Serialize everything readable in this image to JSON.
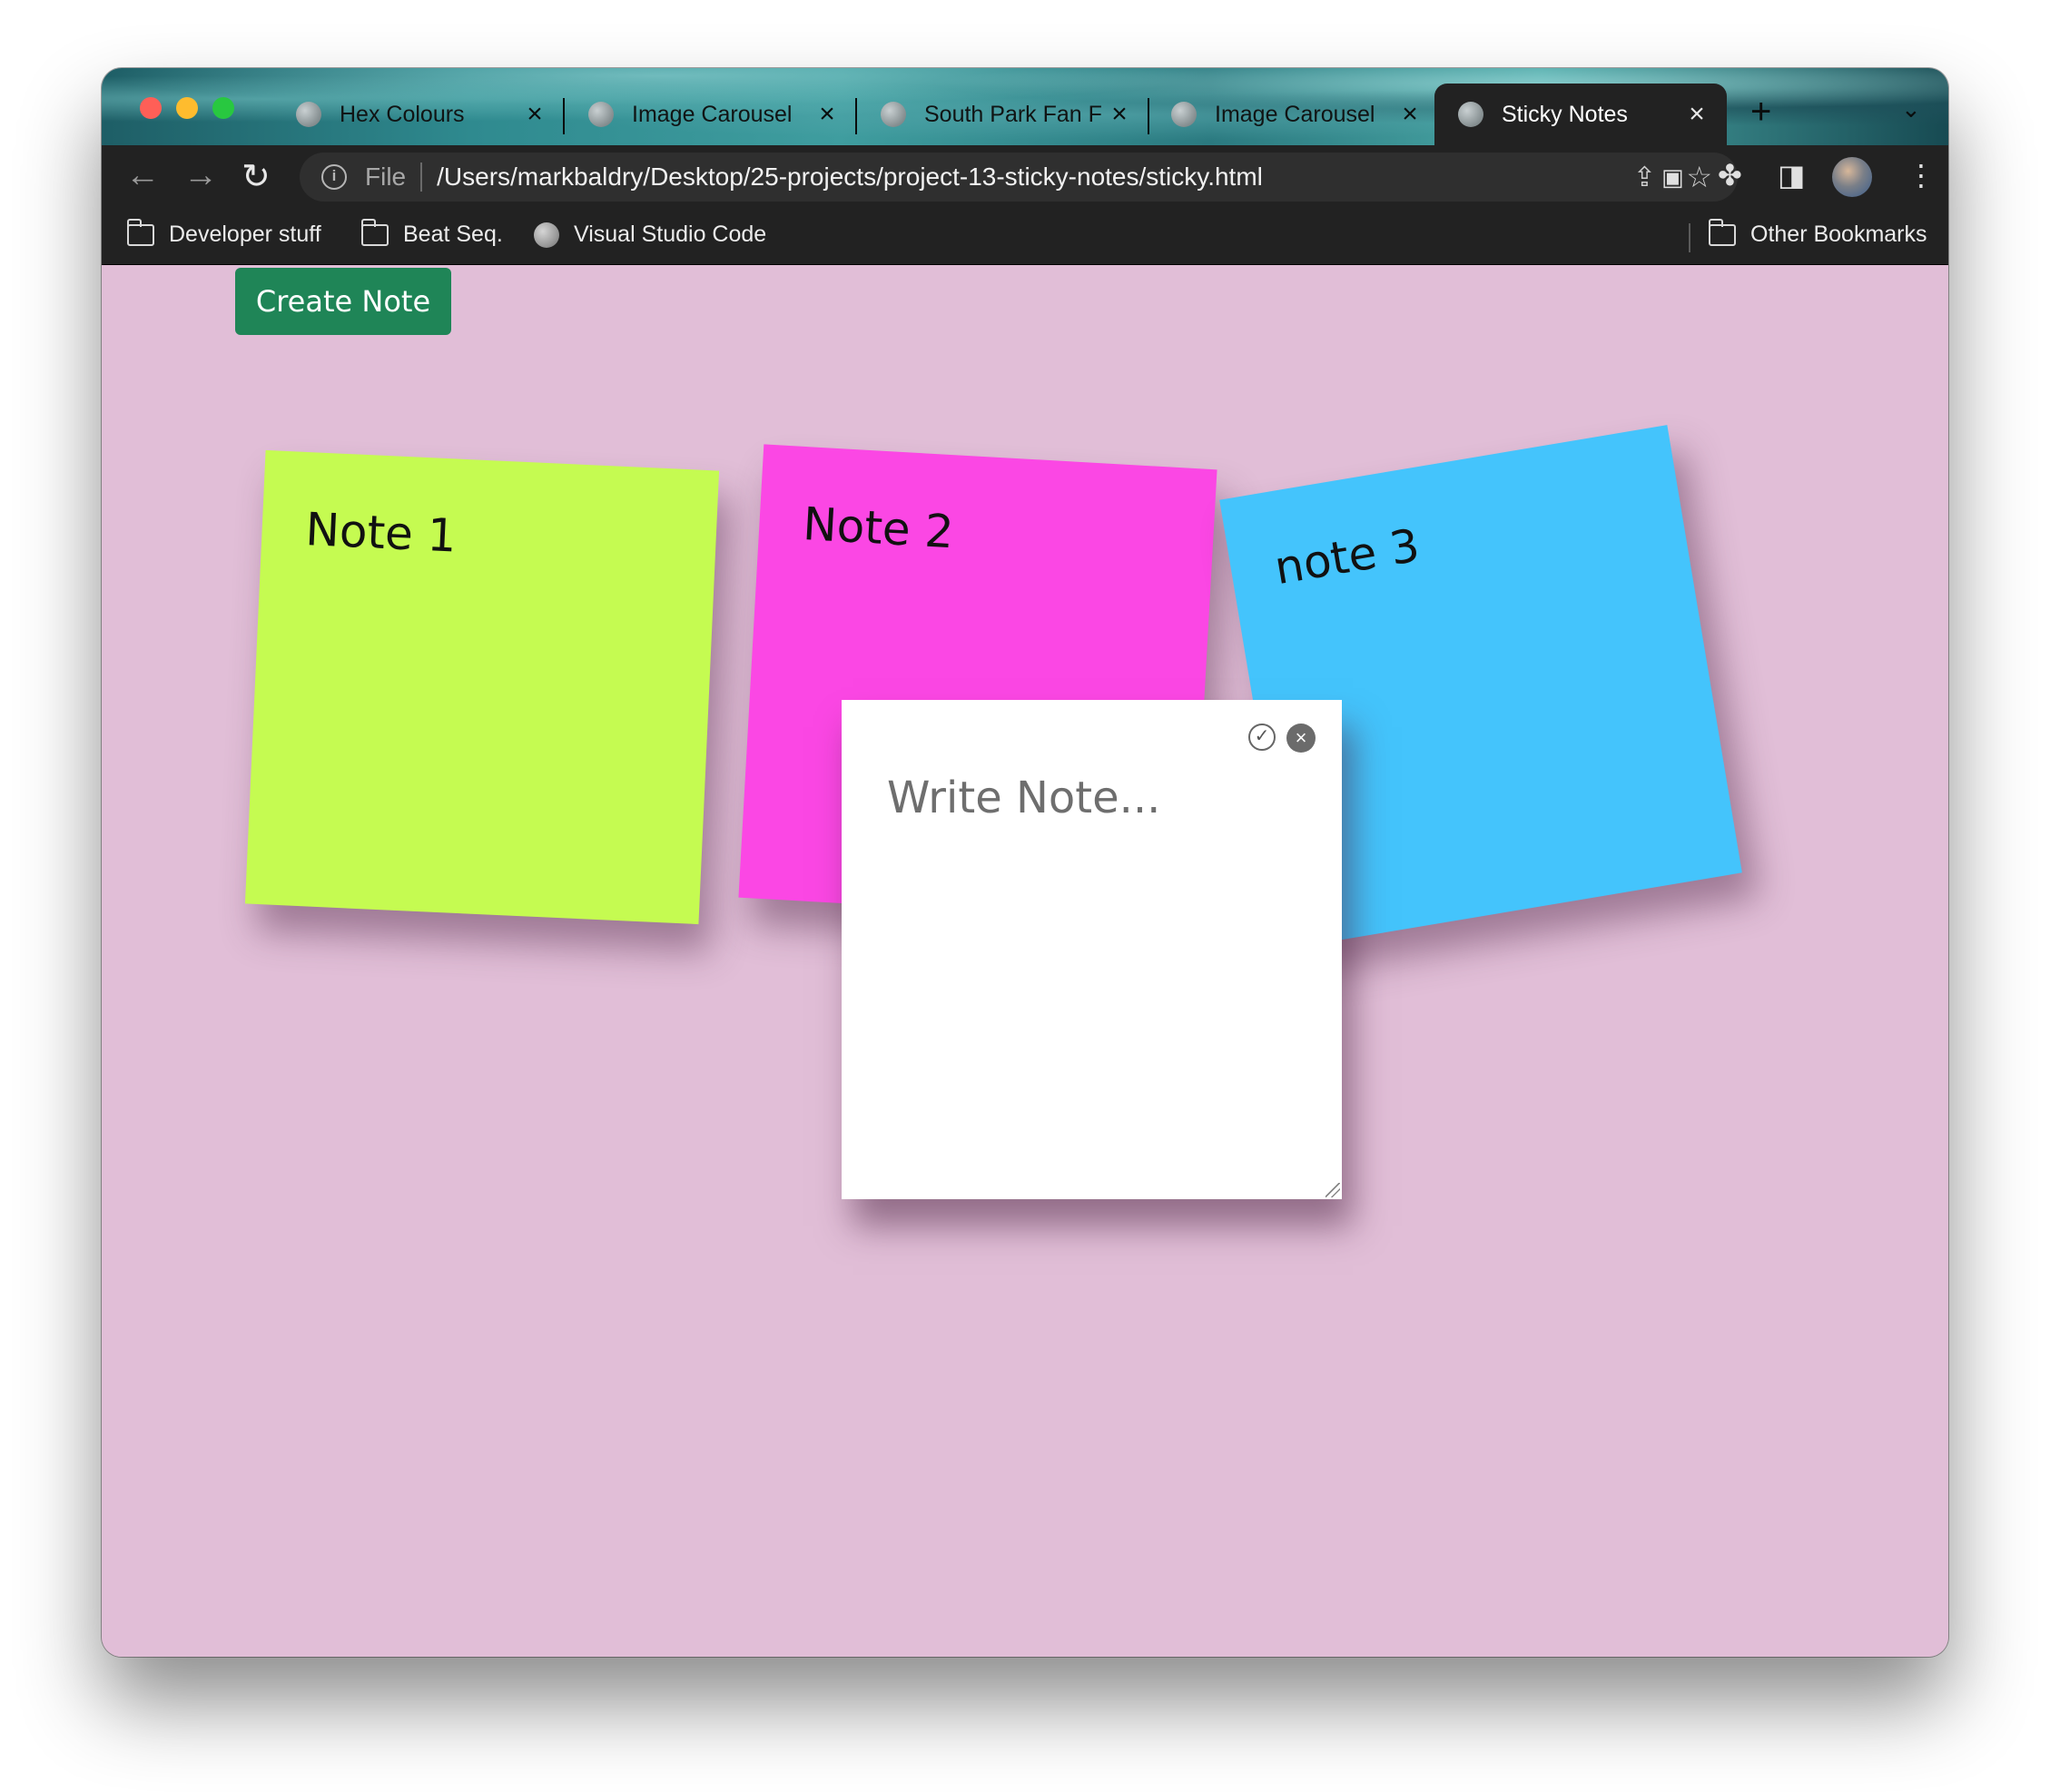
{
  "browser": {
    "tabs": [
      {
        "title": "Hex Colours"
      },
      {
        "title": "Image Carousel"
      },
      {
        "title": "South Park Fan F"
      },
      {
        "title": "Image Carousel"
      },
      {
        "title": "Sticky Notes"
      }
    ],
    "address": {
      "scheme": "File",
      "url": "/Users/markbaldry/Desktop/25-projects/project-13-sticky-notes/sticky.html"
    },
    "bookmarks": [
      {
        "label": "Developer stuff",
        "icon": "folder-icon"
      },
      {
        "label": "Beat Seq.",
        "icon": "folder-icon"
      },
      {
        "label": "Visual Studio Code",
        "icon": "globe-icon"
      }
    ],
    "other_bookmarks": "Other Bookmarks"
  },
  "page": {
    "create_button": "Create Note",
    "notes": [
      {
        "text": "Note 1",
        "color": "#c5fb51"
      },
      {
        "text": "Note 2",
        "color": "#fb47e4"
      },
      {
        "text": "note 3",
        "color": "#44c4fc"
      }
    ],
    "editor": {
      "placeholder": "Write Note..."
    },
    "background": "#e1bed7",
    "button_color": "#1f8557"
  }
}
